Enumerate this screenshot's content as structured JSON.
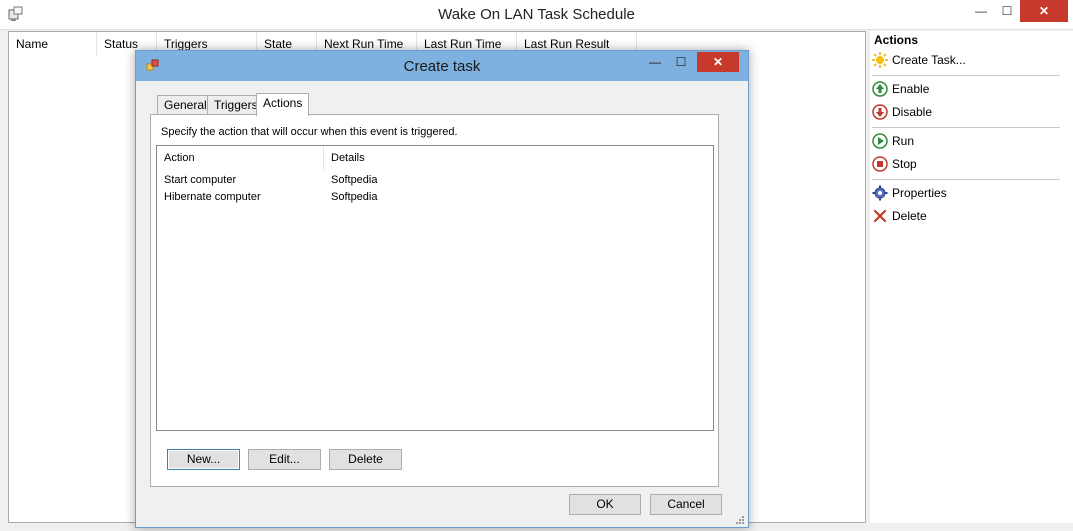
{
  "window": {
    "title": "Wake On LAN Task Schedule",
    "minimize": "—",
    "maximize": "☐",
    "close": "✕"
  },
  "task_list": {
    "columns": [
      "Name",
      "Status",
      "Triggers",
      "State",
      "Next Run Time",
      "Last Run Time",
      "Last Run Result"
    ]
  },
  "actions_pane": {
    "title": "Actions",
    "items": [
      {
        "label": "Create Task...",
        "icon": "sun-icon"
      },
      {
        "label": "Enable",
        "icon": "up-arrow-circle-icon"
      },
      {
        "label": "Disable",
        "icon": "down-arrow-circle-icon"
      },
      {
        "label": "Run",
        "icon": "play-circle-icon"
      },
      {
        "label": "Stop",
        "icon": "stop-circle-icon"
      },
      {
        "label": "Properties",
        "icon": "gear-icon"
      },
      {
        "label": "Delete",
        "icon": "x-icon"
      }
    ]
  },
  "dialog": {
    "title": "Create task",
    "minimize": "—",
    "maximize": "☐",
    "close": "✕",
    "tabs": [
      "General",
      "Triggers",
      "Actions"
    ],
    "active_tab": "Actions",
    "instruction": "Specify the action that will occur when this event is triggered.",
    "list_columns": [
      "Action",
      "Details"
    ],
    "rows": [
      {
        "action": "Start computer",
        "details": "Softpedia"
      },
      {
        "action": "Hibernate computer",
        "details": "Softpedia"
      }
    ],
    "buttons": {
      "new": "New...",
      "edit": "Edit...",
      "delete": "Delete",
      "ok": "OK",
      "cancel": "Cancel"
    }
  },
  "colors": {
    "dialog_titlebar": "#7eb0e0",
    "close_button": "#c7392b"
  }
}
